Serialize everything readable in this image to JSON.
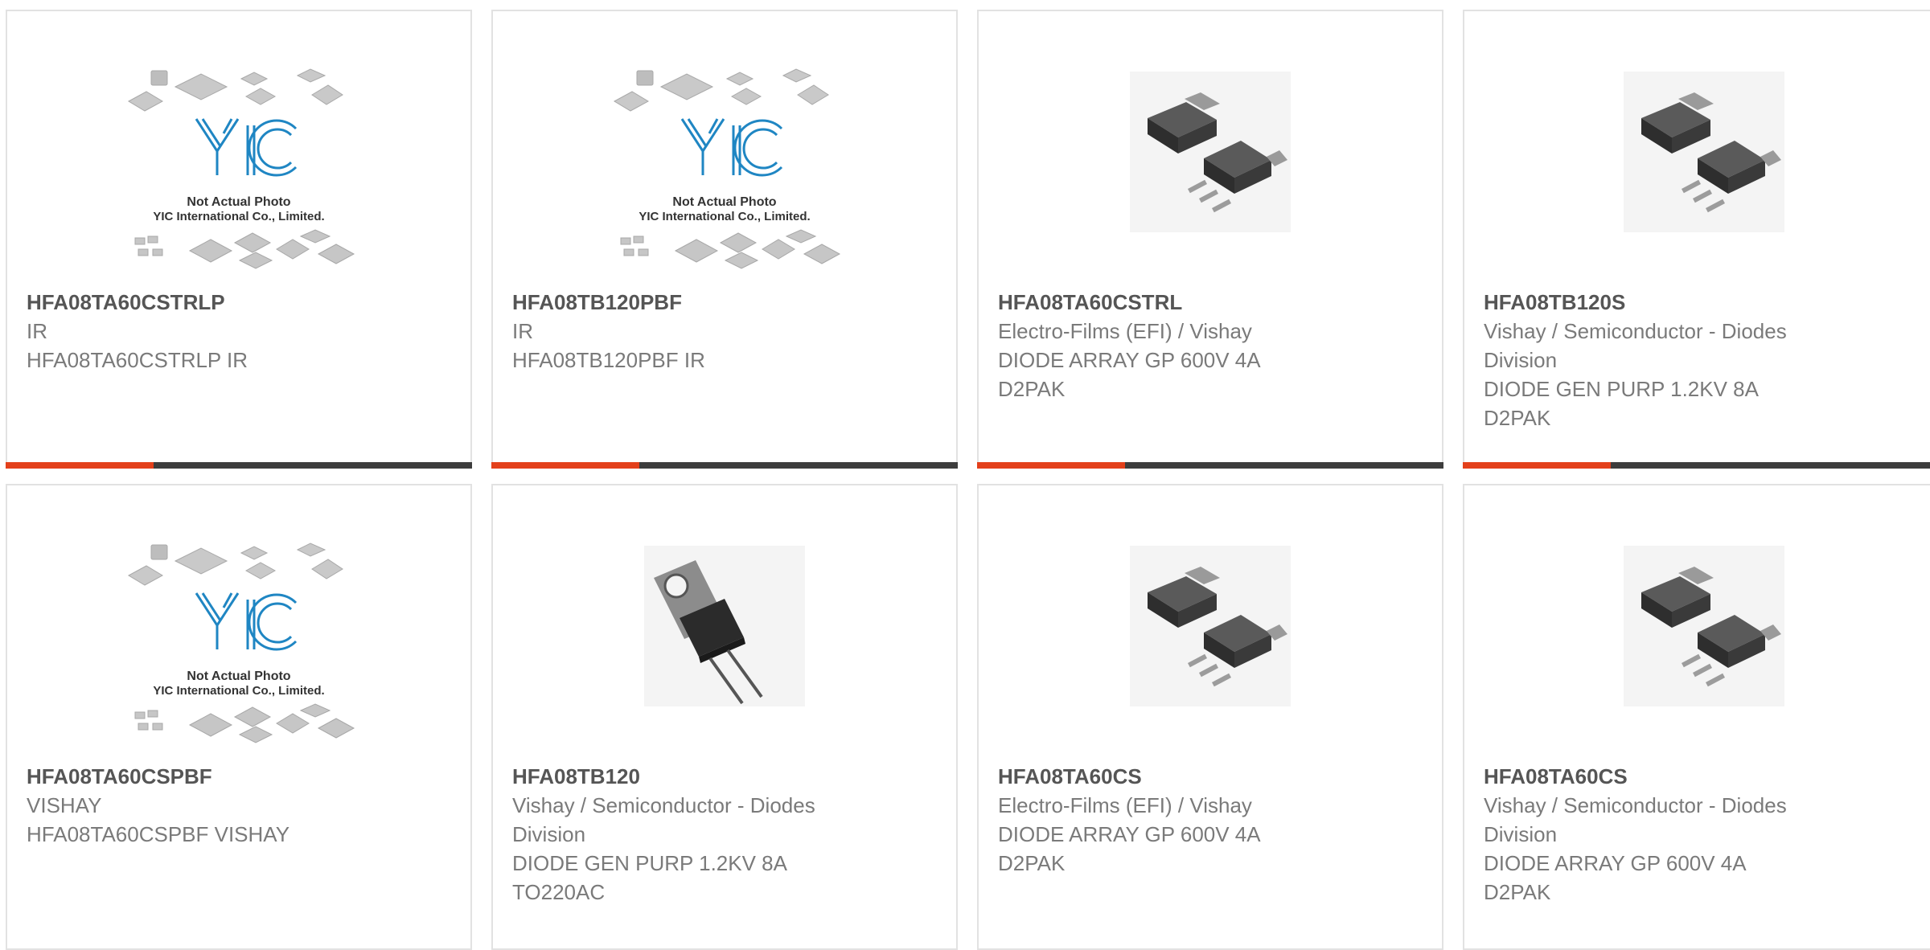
{
  "colors": {
    "accent": "#e3401b",
    "bar": "#3d3d3d",
    "border": "#e2e2e2",
    "yic_blue": "#1f86c3"
  },
  "placeholder": {
    "logo": "YIC",
    "caption_line1": "Not Actual Photo",
    "caption_line2": "YIC International Co., Limited."
  },
  "products": [
    {
      "part": "HFA08TA60CSTRLP",
      "lines": [
        "IR",
        "HFA08TA60CSTRLP IR"
      ],
      "image": "yic-placeholder"
    },
    {
      "part": "HFA08TB120PBF",
      "lines": [
        "IR",
        "HFA08TB120PBF IR"
      ],
      "image": "yic-placeholder"
    },
    {
      "part": "HFA08TA60CSTRL",
      "lines": [
        "Electro-Films (EFI) / Vishay",
        "DIODE ARRAY GP 600V 4A",
        "D2PAK"
      ],
      "image": "d2pak-photo"
    },
    {
      "part": "HFA08TB120S",
      "lines": [
        "Vishay / Semiconductor - Diodes",
        "Division",
        "DIODE GEN PURP 1.2KV 8A",
        "D2PAK"
      ],
      "image": "d2pak-photo"
    },
    {
      "part": "HFA08TA60CSPBF",
      "lines": [
        "VISHAY",
        "HFA08TA60CSPBF VISHAY"
      ],
      "image": "yic-placeholder"
    },
    {
      "part": "HFA08TB120",
      "lines": [
        "Vishay / Semiconductor - Diodes",
        "Division",
        "DIODE GEN PURP 1.2KV 8A",
        "TO220AC"
      ],
      "image": "to220-photo"
    },
    {
      "part": "HFA08TA60CS",
      "lines": [
        "Electro-Films (EFI) / Vishay",
        "DIODE ARRAY GP 600V 4A",
        "D2PAK"
      ],
      "image": "d2pak-photo"
    },
    {
      "part": "HFA08TA60CS",
      "lines": [
        "Vishay / Semiconductor - Diodes",
        "Division",
        "DIODE ARRAY GP 600V 4A",
        "D2PAK"
      ],
      "image": "d2pak-photo"
    }
  ]
}
